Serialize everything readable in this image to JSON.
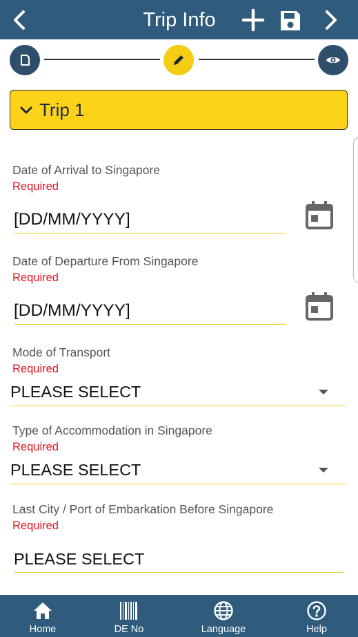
{
  "header": {
    "title": "Trip Info",
    "icons": [
      "back-chevron-icon",
      "plus-icon",
      "save-floppy-icon",
      "next-chevron-icon"
    ]
  },
  "stepper": {
    "steps": [
      {
        "icon": "document-icon",
        "state": "done"
      },
      {
        "icon": "pencil-icon",
        "state": "active"
      },
      {
        "icon": "eye-icon",
        "state": "upcoming"
      }
    ]
  },
  "section": {
    "title": "Trip 1",
    "icon": "chevron-down-icon"
  },
  "form": {
    "arrival": {
      "label": "Date of Arrival to Singapore",
      "required": "Required",
      "value": "[DD/MM/YYYY]"
    },
    "departure": {
      "label": "Date of Departure From Singapore",
      "required": "Required",
      "value": "[DD/MM/YYYY]"
    },
    "transport": {
      "label": "Mode of Transport",
      "required": "Required",
      "value": "PLEASE SELECT"
    },
    "accommodation": {
      "label": "Type of Accommodation in Singapore",
      "required": "Required",
      "value": "PLEASE SELECT"
    },
    "last_city": {
      "label": "Last City / Port of Embarkation Before Singapore",
      "required": "Required",
      "value": "PLEASE SELECT"
    }
  },
  "bottom_nav": {
    "home": "Home",
    "de_no": "DE No",
    "language": "Language",
    "help": "Help"
  },
  "colors": {
    "header_bg": "#2f5b7c",
    "accent_yellow": "#fdd31a",
    "step_dark": "#2f4e6b",
    "required_red": "#e0141e"
  }
}
